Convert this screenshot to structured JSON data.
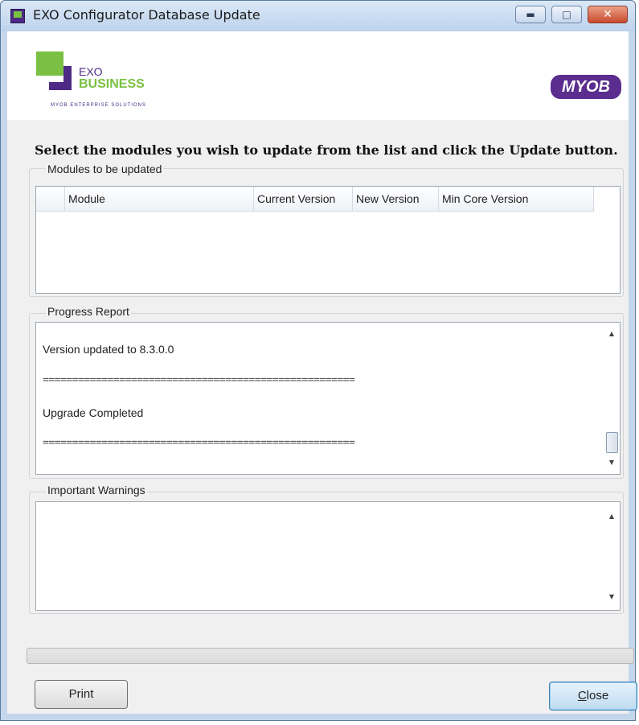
{
  "window": {
    "title": "EXO Configurator Database Update",
    "controls": {
      "minimize": "▬",
      "maximize": "□",
      "close": "✕"
    }
  },
  "logo": {
    "exo": "EXO",
    "business": "BUSINESS",
    "tagline": "MYOB ENTERPRISE SOLUTIONS",
    "brand": "MYOB"
  },
  "instruction": "Select the modules you wish to update from the list and click the Update button.",
  "modules": {
    "label": "Modules to be updated",
    "columns": [
      "Module",
      "Current Version",
      "New Version",
      "Min Core Version"
    ]
  },
  "progress_report": {
    "label": "Progress Report",
    "lines": [
      "Version updated to 8.3.0.0",
      "=====================================================",
      "Upgrade Completed",
      "====================================================="
    ]
  },
  "warnings": {
    "label": "Important Warnings"
  },
  "scroll": {
    "up": "▲",
    "down": "▼"
  },
  "buttons": {
    "print": "Print",
    "close_first": "C",
    "close_rest": "lose"
  },
  "colors": {
    "exo_green": "#7ac143",
    "exo_purple": "#4c2a86",
    "myob_purple": "#5a2d8e"
  }
}
